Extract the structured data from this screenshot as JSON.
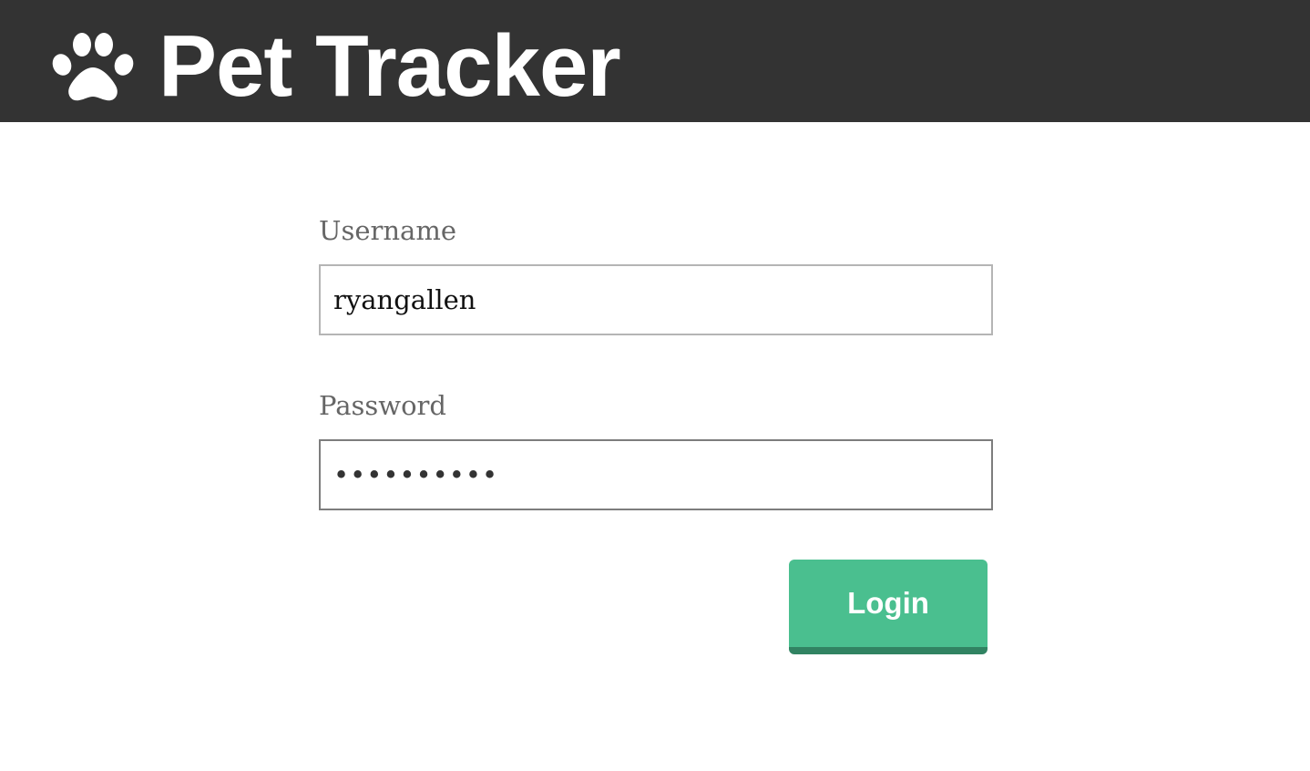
{
  "header": {
    "logo_icon": "paw-icon",
    "title": "Pet Tracker",
    "background_color": "#333333"
  },
  "login_form": {
    "username_label": "Username",
    "username_value": "ryangallen",
    "password_label": "Password",
    "password_masked_value": "••••••••••",
    "login_button_label": "Login",
    "button_color": "#4abf8f"
  }
}
